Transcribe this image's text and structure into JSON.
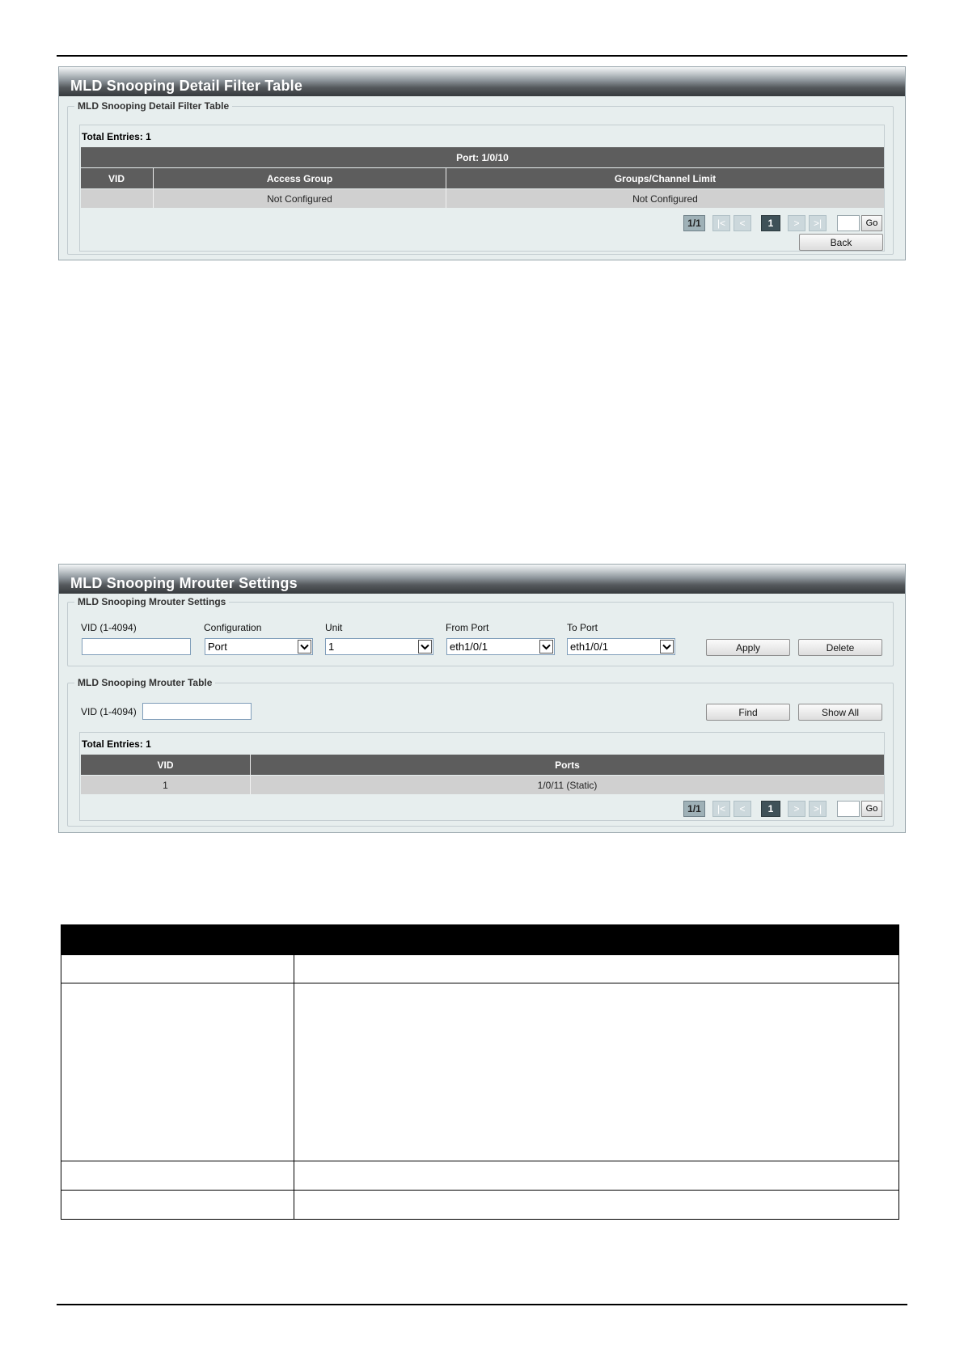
{
  "filter_panel": {
    "title": "MLD Snooping Detail Filter Table",
    "legend": "MLD Snooping Detail Filter Table",
    "total_entries": "Total Entries: 1",
    "port_header": "Port: 1/0/10",
    "columns": [
      "VID",
      "Access Group",
      "Groups/Channel Limit"
    ],
    "rows": [
      {
        "vid": "",
        "access_group": "Not Configured",
        "limit": "Not Configured"
      }
    ],
    "pager": {
      "info": "1/1",
      "first": "|<",
      "prev": "<",
      "current": "1",
      "next": ">",
      "last": ">|",
      "go": "Go"
    },
    "back_label": "Back"
  },
  "mrouter_panel": {
    "title": "MLD Snooping Mrouter Settings",
    "settings_legend": "MLD Snooping Mrouter Settings",
    "form": {
      "vid_label": "VID (1-4094)",
      "vid_value": "",
      "configuration_label": "Configuration",
      "configuration_value": "Port",
      "unit_label": "Unit",
      "unit_value": "1",
      "from_port_label": "From Port",
      "from_port_value": "eth1/0/1",
      "to_port_label": "To Port",
      "to_port_value": "eth1/0/1",
      "apply_label": "Apply",
      "delete_label": "Delete"
    },
    "table_legend": "MLD Snooping Mrouter Table",
    "search": {
      "vid_label": "VID (1-4094)",
      "vid_value": "",
      "find_label": "Find",
      "show_all_label": "Show All"
    },
    "total_entries": "Total Entries: 1",
    "columns": [
      "VID",
      "Ports"
    ],
    "rows": [
      {
        "vid": "1",
        "ports": "1/0/11 (Static)"
      }
    ],
    "pager": {
      "info": "1/1",
      "first": "|<",
      "prev": "<",
      "current": "1",
      "next": ">",
      "last": ">|",
      "go": "Go"
    }
  },
  "icons": {
    "select_arrow": "chevron-down-icon"
  }
}
